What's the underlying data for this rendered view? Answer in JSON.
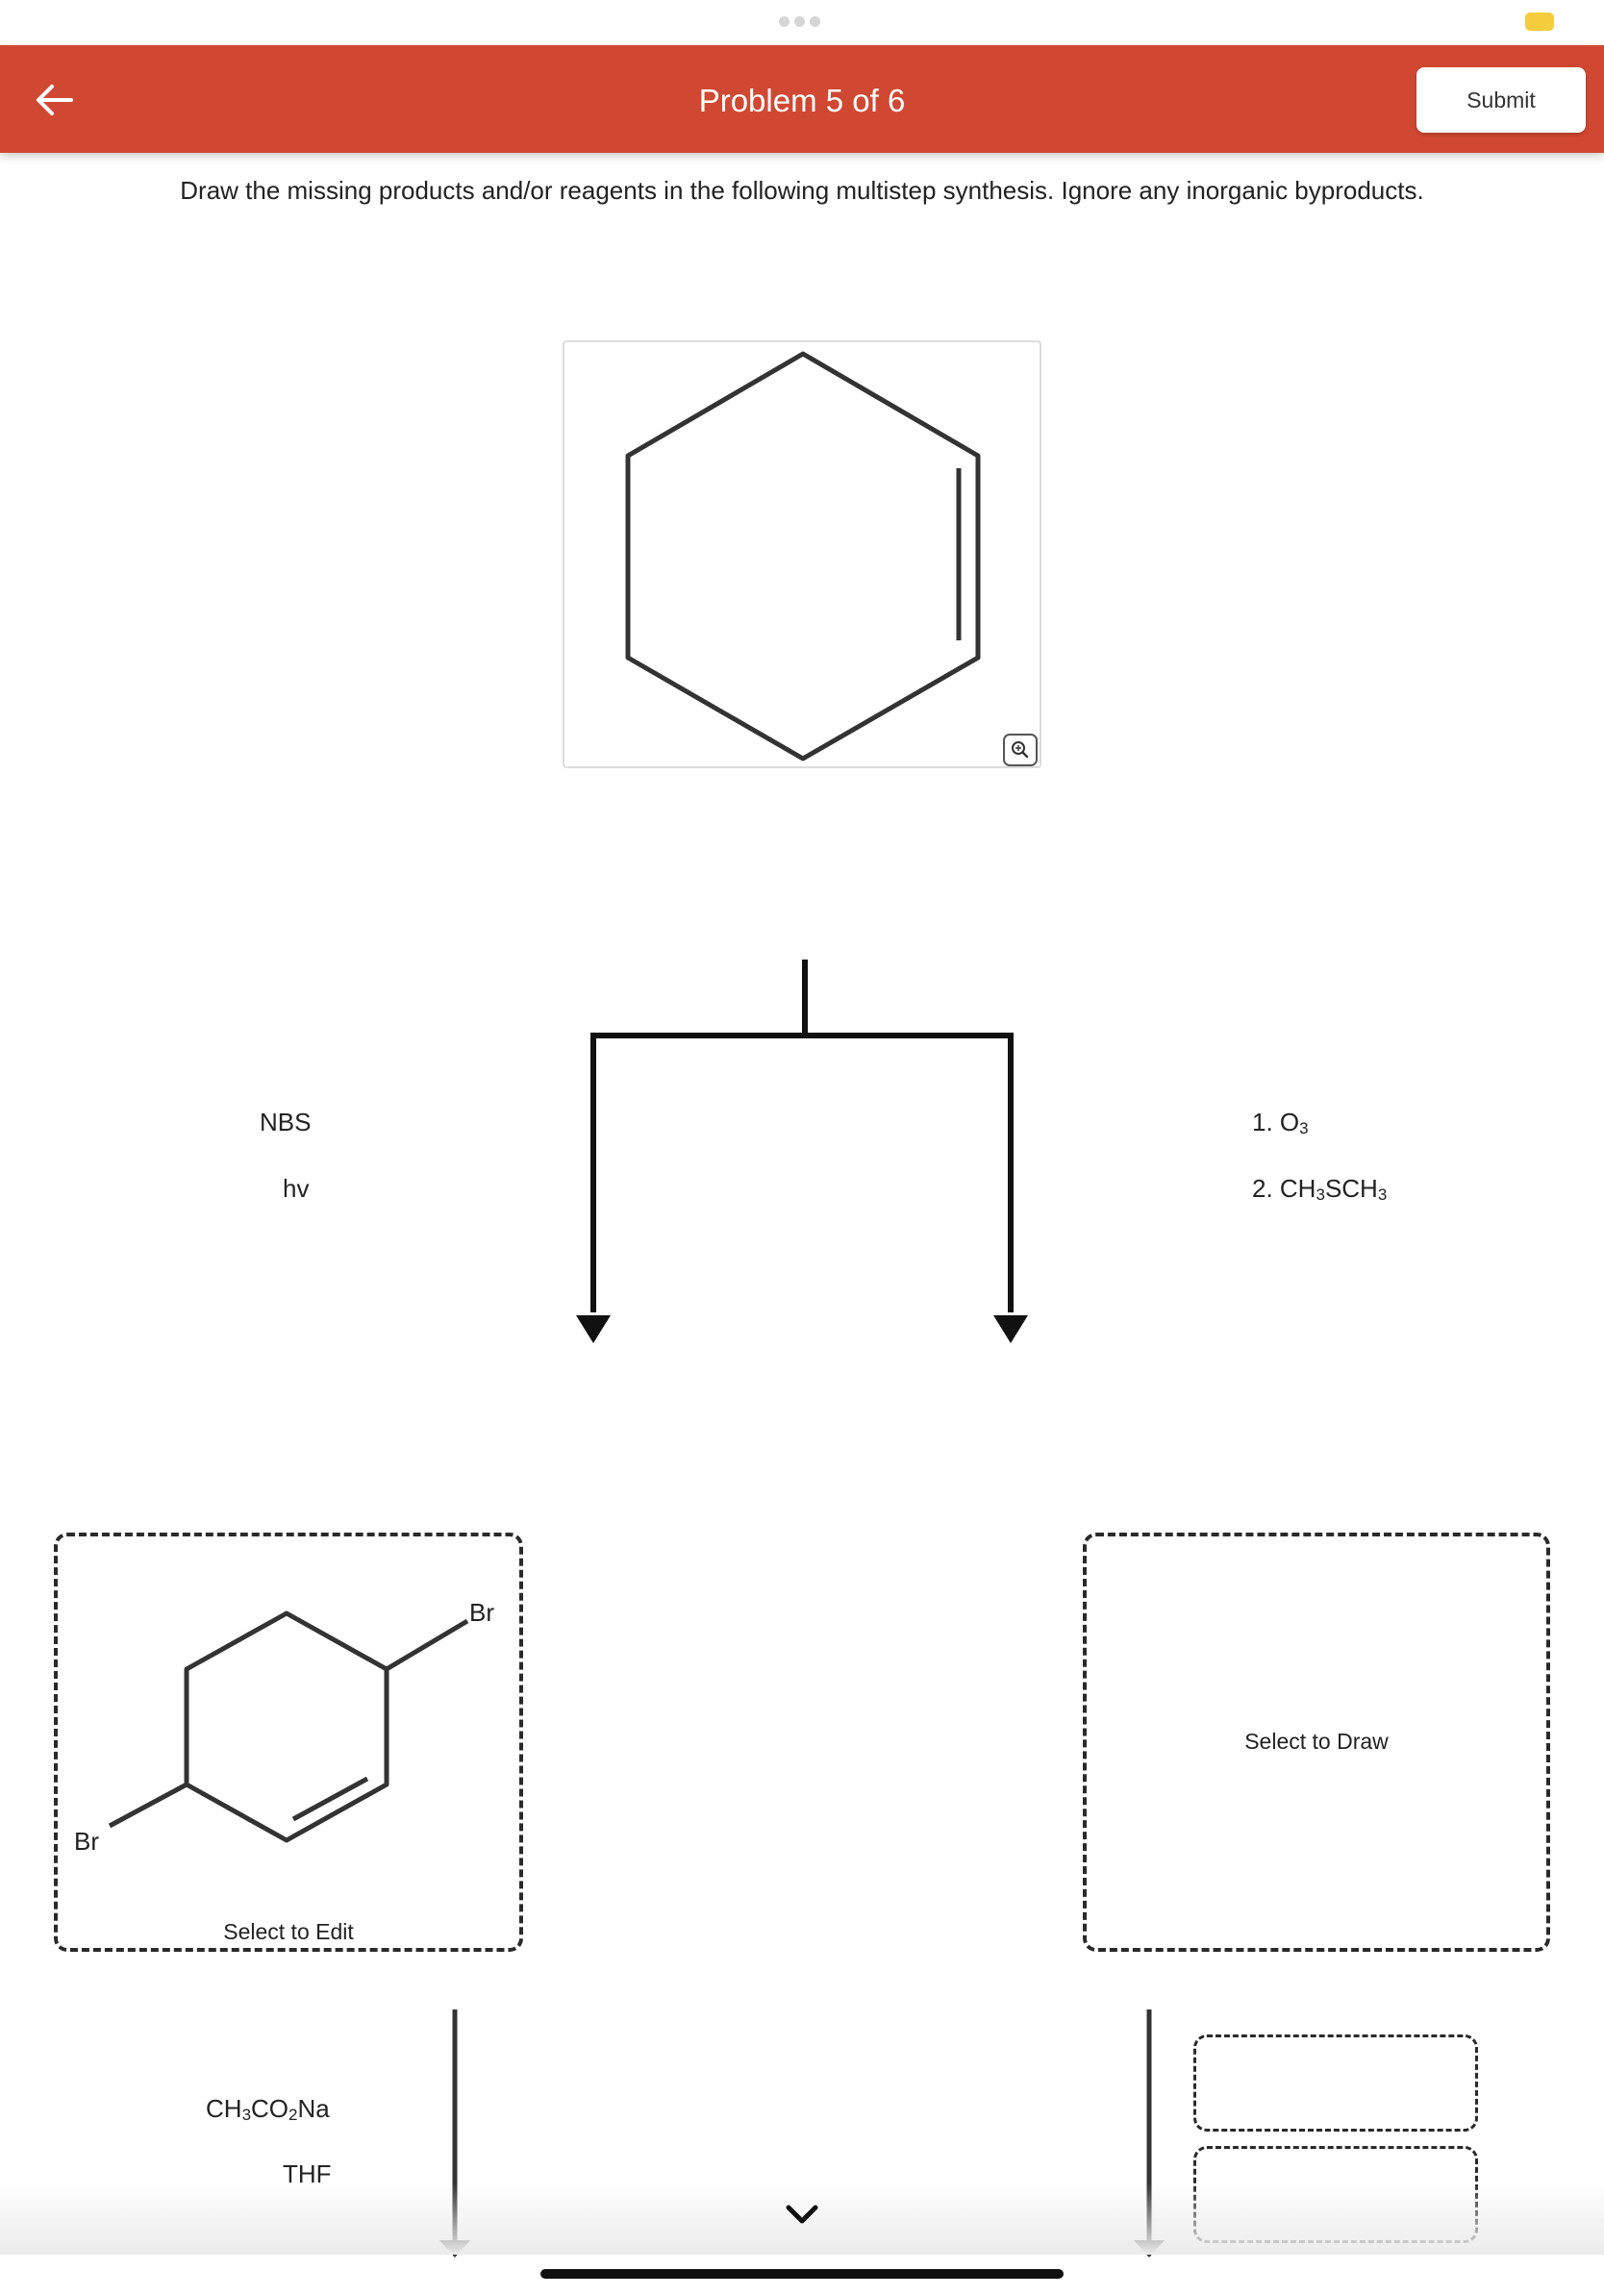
{
  "header": {
    "title": "Problem 5 of 6",
    "submit_label": "Submit",
    "brand_color": "#d14832"
  },
  "instructions": "Draw the missing products and/or reagents in the following multistep synthesis. Ignore any inorganic byproducts.",
  "starting_material": {
    "structure": "cyclohexene"
  },
  "left_branch": {
    "reagents": [
      {
        "parts": [
          "NBS"
        ]
      },
      {
        "parts": [
          "hv"
        ]
      }
    ],
    "product": {
      "substituent_labels": [
        "Br",
        "Br"
      ],
      "action_label": "Select to Edit"
    },
    "next_reagents": [
      {
        "parts": [
          "CH",
          "3",
          "CO",
          "2",
          "Na"
        ]
      },
      {
        "parts": [
          "THF"
        ]
      }
    ]
  },
  "right_branch": {
    "reagents": [
      {
        "parts": [
          "1. O",
          "3"
        ]
      },
      {
        "parts": [
          "2. CH",
          "3",
          "SCH",
          "3"
        ]
      }
    ],
    "product": {
      "action_label": "Select to Draw"
    }
  }
}
